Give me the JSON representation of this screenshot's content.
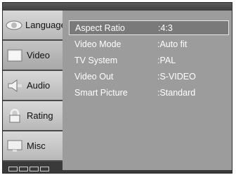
{
  "sidebar": {
    "items": [
      {
        "label": "Language",
        "icon": "eye-icon"
      },
      {
        "label": "Video",
        "icon": "screen-icon"
      },
      {
        "label": "Audio",
        "icon": "speaker-icon"
      },
      {
        "label": "Rating",
        "icon": "lock-icon"
      },
      {
        "label": "Misc",
        "icon": "tv-icon"
      }
    ],
    "active_index": 1
  },
  "settings": {
    "rows": [
      {
        "name": "Aspect Ratio",
        "value": ":4:3"
      },
      {
        "name": "Video Mode",
        "value": ":Auto fit"
      },
      {
        "name": "TV System",
        "value": ":PAL"
      },
      {
        "name": "Video Out",
        "value": ":S-VIDEO"
      },
      {
        "name": "Smart Picture",
        "value": ":Standard"
      }
    ],
    "selected_index": 0
  },
  "colors": {
    "panel": "#9c9c9c",
    "frame": "#3a3a3a",
    "text": "#ffffff"
  }
}
